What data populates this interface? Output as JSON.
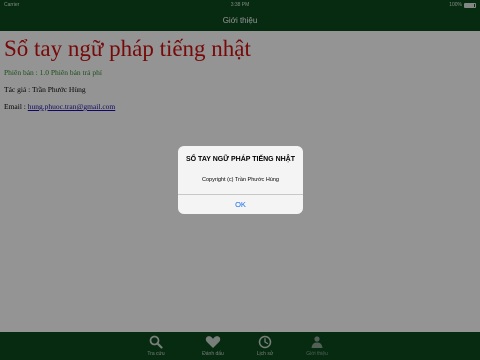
{
  "status_bar": {
    "carrier": "Carrier",
    "time": "3:38 PM",
    "battery": "100%"
  },
  "nav": {
    "title": "Giới thiệu"
  },
  "content": {
    "app_title": "Sổ tay ngữ pháp tiếng nhật",
    "version": "Phiên bản : 1.0 Phiên bản trả phí",
    "author": "Tác giả : Trần Phước Hùng",
    "email_label": "Email : ",
    "email": "hung.phuoc.tran@gmail.com"
  },
  "alert": {
    "title": "SỔ TAY NGỮ PHÁP TIẾNG NHẬT",
    "message": "Copyright (c) Trần Phước Hùng",
    "ok_label": "OK"
  },
  "tabs": [
    {
      "label": "Tra cứu",
      "icon": "search-icon"
    },
    {
      "label": "Đánh dấu",
      "icon": "heart-icon"
    },
    {
      "label": "Lịch sử",
      "icon": "clock-icon"
    },
    {
      "label": "Giới thiệu",
      "icon": "info-icon"
    }
  ],
  "colors": {
    "bar": "#0b4a1e",
    "title": "#cc1111",
    "version": "#2e8b2e",
    "link": "#1a0dab",
    "alert_button": "#1a6ff0"
  }
}
